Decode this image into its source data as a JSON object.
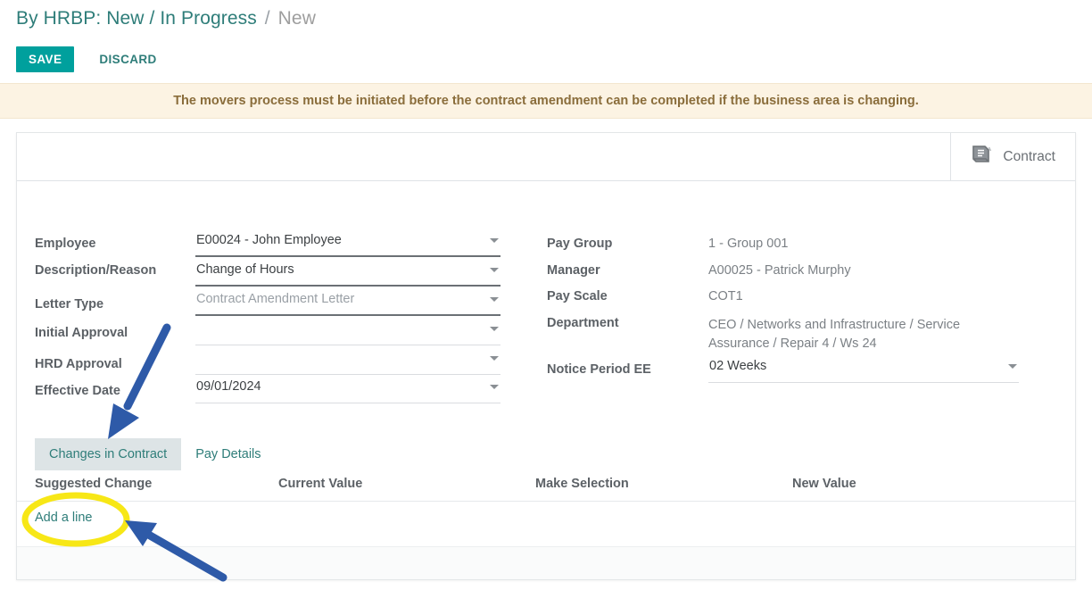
{
  "breadcrumb": {
    "active": "By HRBP: New / In Progress",
    "separator": "/",
    "current": "New"
  },
  "toolbar": {
    "save_label": "SAVE",
    "discard_label": "DISCARD"
  },
  "alert": {
    "message": "The movers process must be initiated before the contract amendment can be completed if the business area is changing."
  },
  "card_header": {
    "contract_tab_label": "Contract",
    "contract_tab_icon": "book-icon"
  },
  "form": {
    "left": [
      {
        "label": "Employee",
        "value": "E00024 - John Employee",
        "muted": false
      },
      {
        "label": "Description/Reason",
        "value": "Change of Hours",
        "muted": false
      },
      {
        "label": "Letter Type",
        "value": "Contract Amendment Letter",
        "muted": true
      },
      {
        "label": "Initial Approval",
        "value": "",
        "muted": false
      },
      {
        "label": "HRD Approval",
        "value": "",
        "muted": false
      },
      {
        "label": "Effective Date",
        "value": "09/01/2024",
        "muted": false
      }
    ],
    "right": [
      {
        "label": "Pay Group",
        "value": "1 - Group 001"
      },
      {
        "label": "Manager",
        "value": "A00025 - Patrick Murphy"
      },
      {
        "label": "Pay Scale",
        "value": "COT1"
      },
      {
        "label": "Department",
        "value": "CEO / Networks and Infrastructure / Service Assurance / Repair 4 / Ws 24"
      }
    ],
    "notice_period": {
      "label": "Notice Period EE",
      "value": "02 Weeks"
    }
  },
  "tabs": [
    {
      "label": "Changes in Contract",
      "active": true
    },
    {
      "label": "Pay Details",
      "active": false
    }
  ],
  "table": {
    "columns": [
      "Suggested Change",
      "Current Value",
      "Make Selection",
      "New Value"
    ],
    "rows": [],
    "add_line_label": "Add a line"
  },
  "annotations": {
    "highlight_color": "#f7e716",
    "arrow_color": "#2e5aa8",
    "highlight_target": "Add a line",
    "arrow_targets": [
      "Changes in Contract",
      "Add a line"
    ]
  },
  "colors": {
    "accent_teal": "#00a09d",
    "breadcrumb_teal": "#2e7d79",
    "alert_bg": "#fcf3e3",
    "alert_text": "#8a6d3b"
  }
}
